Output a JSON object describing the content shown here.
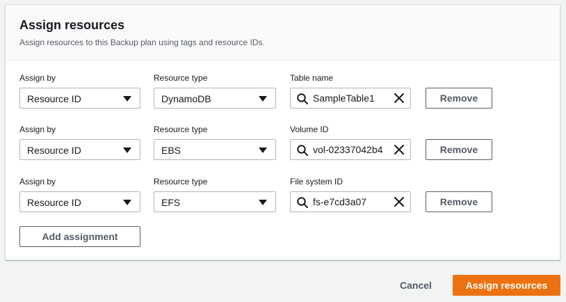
{
  "header": {
    "title": "Assign resources",
    "description": "Assign resources to this Backup plan using tags and resource IDs."
  },
  "rows": [
    {
      "assign_by_label": "Assign by",
      "assign_by_value": "Resource ID",
      "resource_type_label": "Resource type",
      "resource_type_value": "DynamoDB",
      "id_label": "Table name",
      "id_value": "SampleTable1",
      "remove_label": "Remove"
    },
    {
      "assign_by_label": "Assign by",
      "assign_by_value": "Resource ID",
      "resource_type_label": "Resource type",
      "resource_type_value": "EBS",
      "id_label": "Volume ID",
      "id_value": "vol-02337042b4",
      "remove_label": "Remove"
    },
    {
      "assign_by_label": "Assign by",
      "assign_by_value": "Resource ID",
      "resource_type_label": "Resource type",
      "resource_type_value": "EFS",
      "id_label": "File system ID",
      "id_value": "fs-e7cd3a07",
      "remove_label": "Remove"
    }
  ],
  "add_assignment_label": "Add assignment",
  "footer": {
    "cancel_label": "Cancel",
    "submit_label": "Assign resources"
  },
  "icons": {
    "search": "search-icon",
    "clear": "close-icon",
    "dropdown": "caret-down-icon"
  },
  "colors": {
    "primary": "#ec7211",
    "border": "#aab7b8",
    "text": "#16191f",
    "secondary_text": "#545b64"
  }
}
